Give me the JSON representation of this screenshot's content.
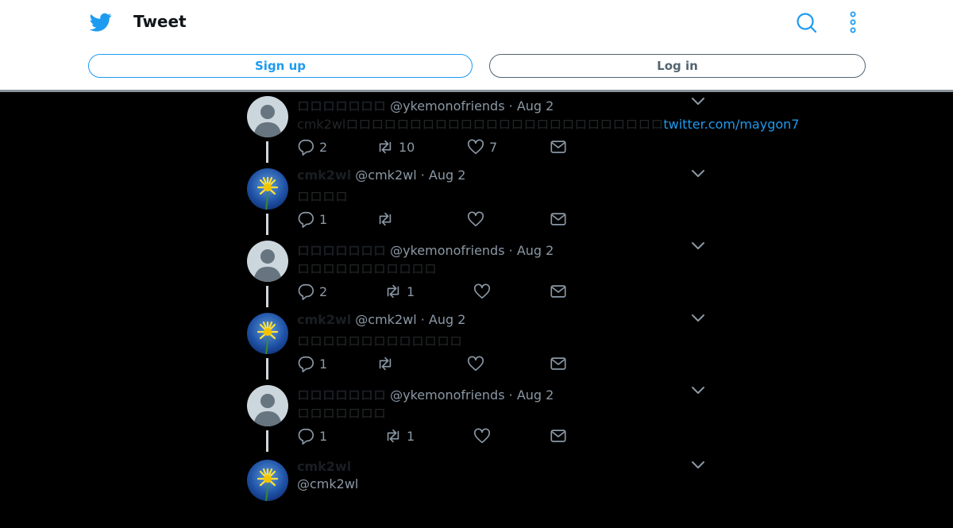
{
  "header": {
    "title": "Tweet",
    "signup_label": "Sign up",
    "login_label": "Log in"
  },
  "colors": {
    "accent": "#1d9bf0",
    "background": "#000000",
    "muted": "#8b98a5"
  },
  "tweets": [
    {
      "name": "ロロロロロロロ",
      "handle": "@ykemonofriends",
      "date": "· Aug 2",
      "text": "cmk2wlロロロロロロロロロロロロロロロロロロロロロロロロロ",
      "link": "twitter.com/maygon7",
      "replies": "2",
      "retweets": "10",
      "likes": "7",
      "avatar": "default"
    },
    {
      "name": "cmk2wl",
      "handle": "@cmk2wl",
      "date": "· Aug 2",
      "text": "ロロロロ",
      "replies": "1",
      "retweets": "",
      "likes": "",
      "avatar": "dandelion"
    },
    {
      "name": "ロロロロロロロ",
      "handle": "@ykemonofriends",
      "date": "· Aug 2",
      "text": "ロロロロロロロロロロロ",
      "replies": "2",
      "retweets": "1",
      "likes": "",
      "avatar": "default"
    },
    {
      "name": "cmk2wl",
      "handle": "@cmk2wl",
      "date": "· Aug 2",
      "text": "ロロロロロロロロロロロロロ",
      "replies": "1",
      "retweets": "",
      "likes": "",
      "avatar": "dandelion"
    },
    {
      "name": "ロロロロロロロ",
      "handle": "@ykemonofriends",
      "date": "· Aug 2",
      "text": "ロロロロロロロ",
      "replies": "1",
      "retweets": "1",
      "likes": "",
      "avatar": "default"
    }
  ],
  "last_tweet": {
    "name": "cmk2wl",
    "handle": "@cmk2wl"
  }
}
